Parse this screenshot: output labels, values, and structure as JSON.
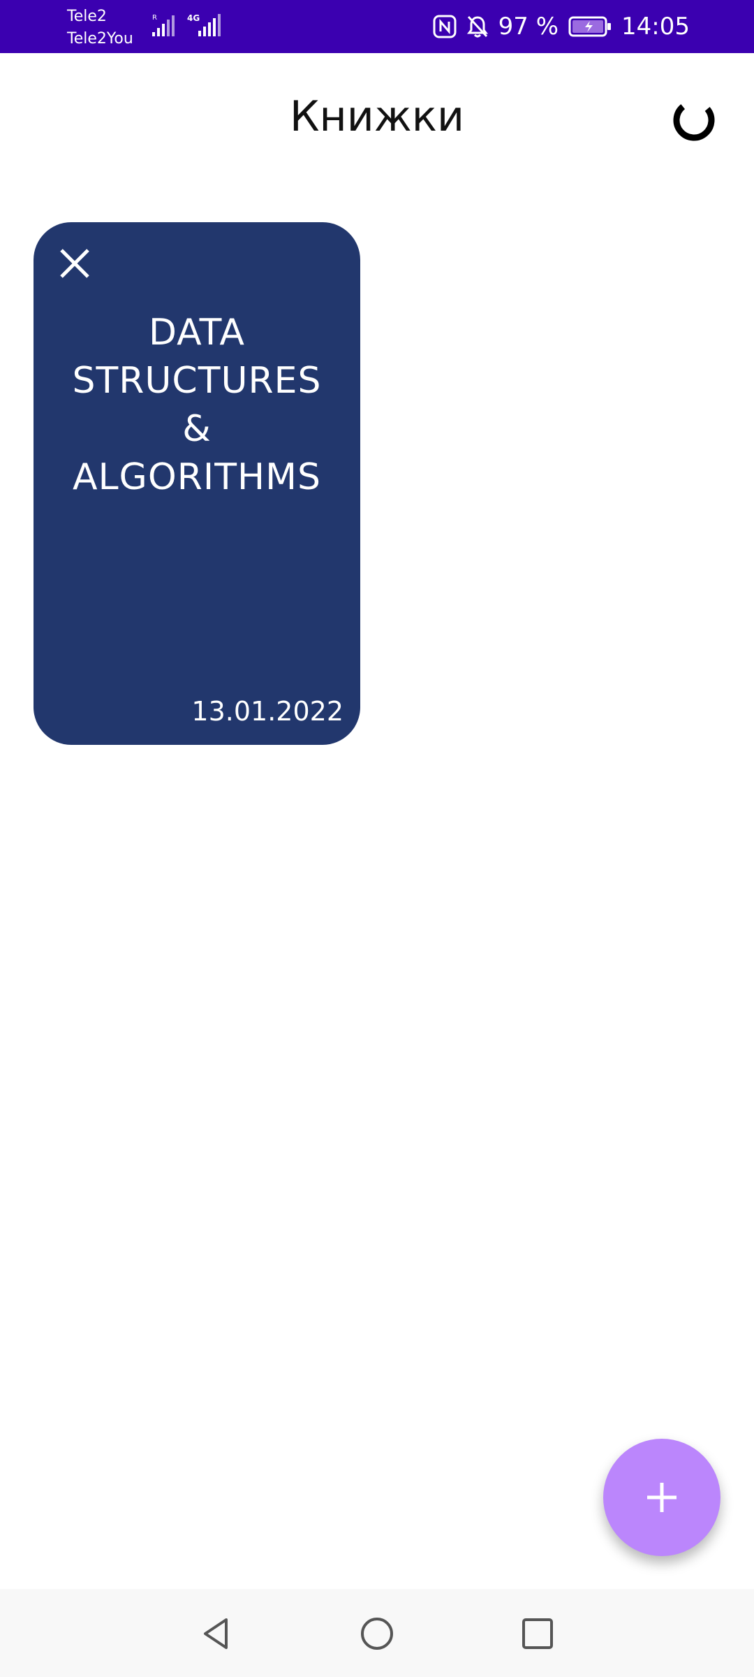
{
  "status_bar": {
    "carrier_1": "Tele2",
    "carrier_2": "Tele2You",
    "signal_1_tag": "R",
    "signal_2_tag": "4G",
    "battery_percent": "97 %",
    "time": "14:05",
    "background_color": "#3b00b0",
    "icons": [
      "signal-icon",
      "nfc-icon",
      "mute-bell-icon",
      "battery-charging-icon"
    ]
  },
  "header": {
    "title": "Книжки",
    "action_icon": "sync-loader-icon"
  },
  "books": [
    {
      "title": "DATA\nSTRUCTURES\n&\nALGORITHMS",
      "date": "13.01.2022",
      "color": "#22376d",
      "delete_icon": "close-icon"
    }
  ],
  "fab": {
    "icon": "plus-icon",
    "color": "#bb86fc"
  },
  "nav_bar": {
    "icons": [
      "back-icon",
      "home-icon",
      "recents-icon"
    ]
  }
}
